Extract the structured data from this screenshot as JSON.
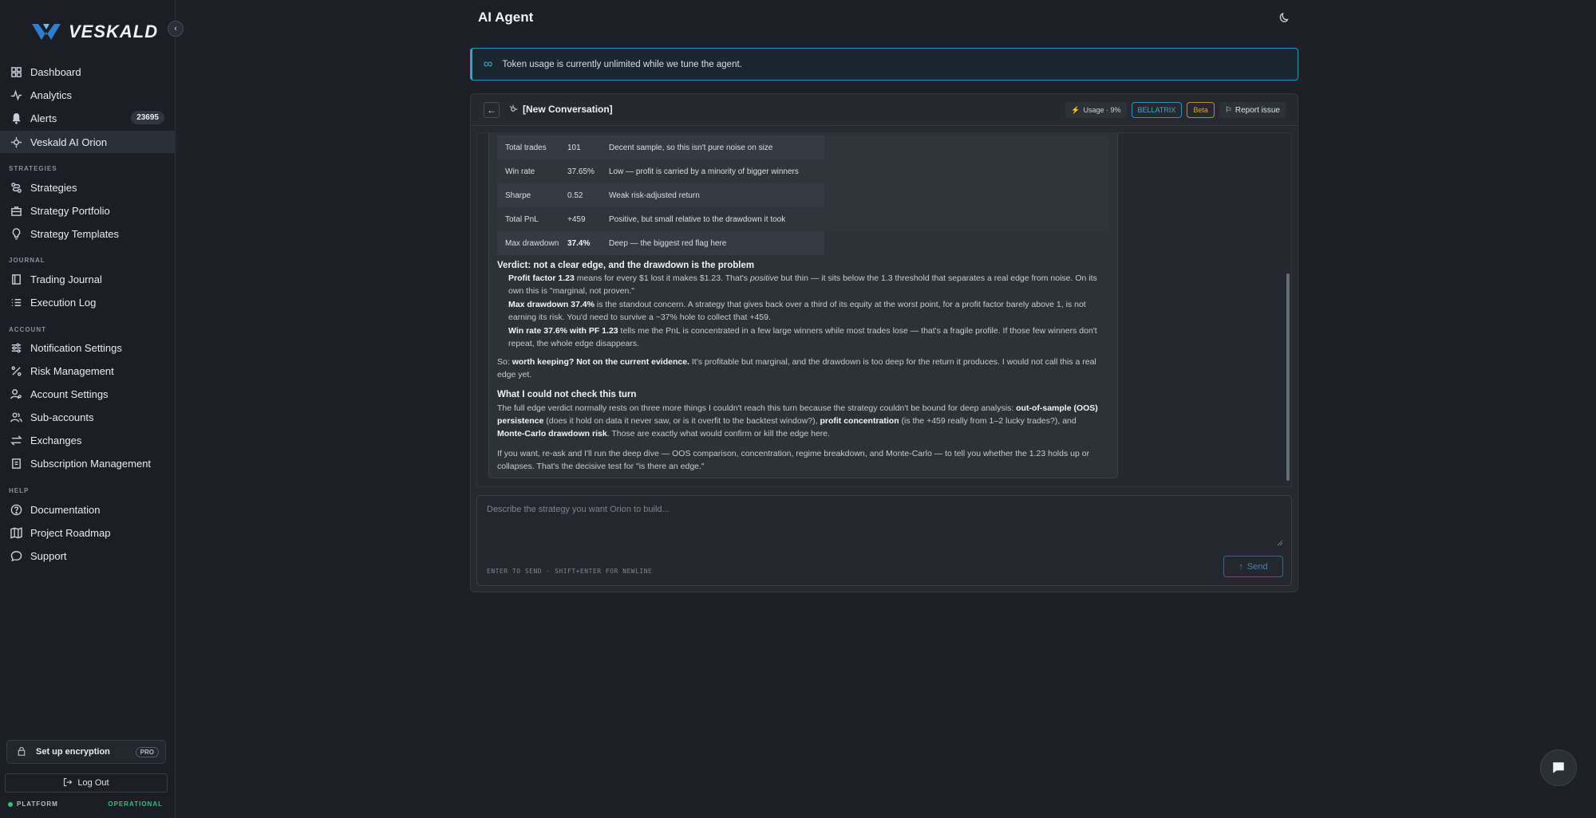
{
  "app": {
    "brand": "VESKALD",
    "page_title": "AI Agent"
  },
  "sidebar": {
    "items": [
      {
        "label": "Dashboard",
        "icon": "grid-icon"
      },
      {
        "label": "Analytics",
        "icon": "pulse-icon"
      },
      {
        "label": "Alerts",
        "icon": "bell-icon",
        "badge": "23695"
      },
      {
        "label": "Veskald AI Orion",
        "icon": "orion-icon",
        "active": true
      }
    ],
    "sections": {
      "strategies": "STRATEGIES",
      "journal": "JOURNAL",
      "account": "ACCOUNT",
      "help": "HELP"
    },
    "strategies": [
      "Strategies",
      "Strategy Portfolio",
      "Strategy Templates"
    ],
    "journal": [
      "Trading Journal",
      "Execution Log"
    ],
    "account": [
      "Notification Settings",
      "Risk Management",
      "Account Settings",
      "Sub-accounts",
      "Exchanges",
      "Subscription Management"
    ],
    "help": [
      "Documentation",
      "Project Roadmap",
      "Support"
    ],
    "encryption_label": "Set up encryption",
    "pro_label": "PRO",
    "logout_label": "Log Out",
    "platform_label": "PLATFORM",
    "platform_status": "OPERATIONAL"
  },
  "banner": {
    "text": "Token usage is currently unlimited while we tune the agent."
  },
  "conversation": {
    "title": "[New Conversation]",
    "usage": "Usage · 9%",
    "model": "BELLATRIX",
    "beta": "Beta",
    "report": "Report issue"
  },
  "metrics_table": [
    {
      "name": "Total trades",
      "value": "101",
      "note": "Decent sample, so this isn't pure noise on size"
    },
    {
      "name": "Win rate",
      "value": "37.65%",
      "note": "Low — profit is carried by a minority of bigger winners"
    },
    {
      "name": "Sharpe",
      "value": "0.52",
      "note": "Weak risk-adjusted return"
    },
    {
      "name": "Total PnL",
      "value": "+459",
      "note": "Positive, but small relative to the drawdown it took"
    },
    {
      "name": "Max drawdown",
      "value": "37.4%",
      "note": "Deep — the biggest red flag here"
    }
  ],
  "message": {
    "verdict_heading": "Verdict: not a clear edge, and the drawdown is the problem",
    "pf_bold": "Profit factor 1.23",
    "pf_text1": " means for every $1 lost it makes $1.23. That's ",
    "pf_em": "positive",
    "pf_text2": " but thin — it sits below the 1.3 threshold that separates a real edge from noise. On its",
    "pf_text3": "own this is \"marginal, not proven.\"",
    "dd_bold": "Max drawdown 37.4%",
    "dd_text1": " is the standout concern. A strategy that gives back over a third of its equity at the worst point, for a profit factor barely above 1, is not",
    "dd_text2": "earning its risk. You'd need to survive a ~37% hole to collect that +459.",
    "wr_bold": "Win rate 37.6% with PF 1.23",
    "wr_text1": " tells me the PnL is concentrated in a few large winners while most trades lose — that's a fragile profile. If those few winners don't",
    "wr_text2": "repeat, the whole edge disappears.",
    "so_text": "So: ",
    "so_bold": "worth keeping? Not on the current evidence.",
    "so_text2": " It's profitable but marginal, and the drawdown is too deep for the return it produces. I would not call this a real",
    "so_text3": "edge yet.",
    "check_heading": "What I could not check this turn",
    "check_text1": "The full edge verdict normally rests on three more things I couldn't reach this turn because the strategy couldn't be bound for deep analysis: ",
    "check_bold1": "out-of-sample (OOS)",
    "check_bold1b": "persistence",
    "check_text2": " (does it hold on data it never saw, or is it overfit to the backtest window?), ",
    "check_bold2": "profit concentration",
    "check_text3": " (is the +459 really from 1–2 lucky trades?), and",
    "check_bold3": "Monte-Carlo drawdown risk",
    "check_text4": ". Those are exactly what would confirm or kill the edge here.",
    "final_text1": "If you want, re-ask and I'll run the deep dive — OOS comparison, concentration, regime breakdown, and Monte-Carlo — to tell you whether the 1.23 holds up or",
    "final_text2": "collapses. That's the decisive test for \"is there an edge.\""
  },
  "composer": {
    "placeholder": "Describe the strategy you want Orion to build...",
    "hint": "ENTER TO SEND · SHIFT+ENTER FOR NEWLINE",
    "send_label": "Send"
  },
  "colors": {
    "accent": "#2ea5cf",
    "beta": "#e0a23e",
    "operational": "#2fc27a"
  }
}
